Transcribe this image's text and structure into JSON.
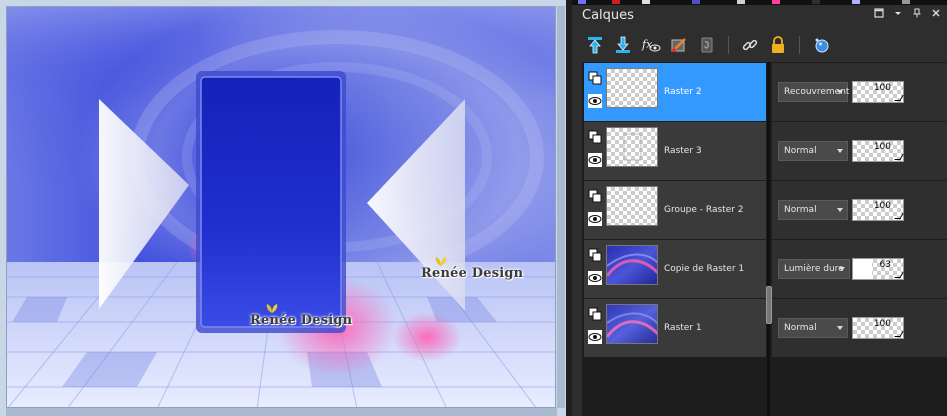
{
  "panel": {
    "title": "Calques",
    "title_buttons": [
      "restore-icon",
      "menu-arrow-icon",
      "pin-icon",
      "close-icon"
    ],
    "toolbar": [
      "layer-up-icon",
      "layer-down-icon",
      "fx-visibility-icon",
      "paintbrush-layer-icon",
      "mask-icon",
      "link-icon",
      "lock-icon",
      "material-icon"
    ],
    "layers": [
      {
        "name": "Raster 2",
        "selected": true,
        "blend": "Recouvrement",
        "opacity": 100
      },
      {
        "name": "Raster 3",
        "selected": false,
        "blend": "Normal",
        "opacity": 100
      },
      {
        "name": "Groupe - Raster 2",
        "selected": false,
        "blend": "Normal",
        "opacity": 100
      },
      {
        "name": "Copie de Raster 1",
        "selected": false,
        "blend": "Lumière dure",
        "opacity": 63
      },
      {
        "name": "Raster 1",
        "selected": false,
        "blend": "Normal",
        "opacity": 100
      }
    ],
    "colors": {
      "selected": "#3399ff",
      "row": "#3a3a3a",
      "background": "#2e2e2e"
    }
  },
  "canvas": {
    "watermark_1": "Renée Design",
    "watermark_2": "Renée Design",
    "colors": {
      "blue": "#1a2bd6",
      "light": "#dfe6ff",
      "pink": "#ff4fa8"
    }
  }
}
